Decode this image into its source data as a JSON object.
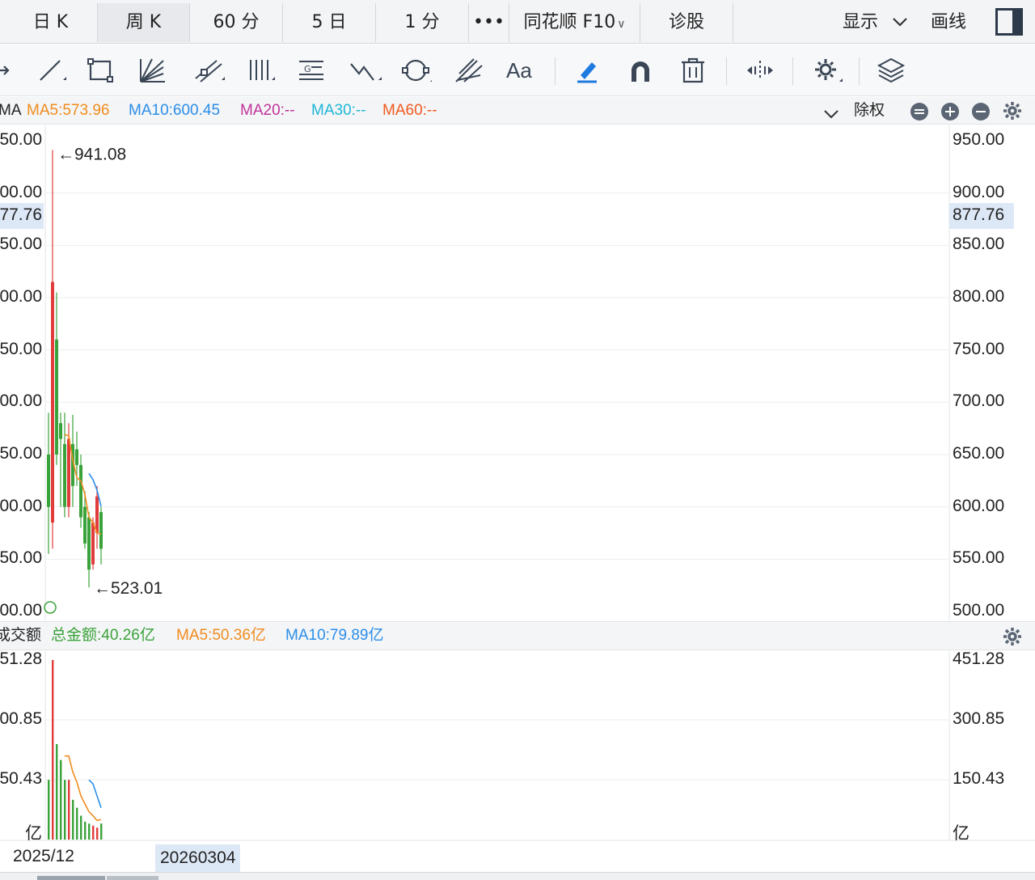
{
  "tabs": [
    {
      "label": "日 K",
      "active": false
    },
    {
      "label": "周 K",
      "active": true
    },
    {
      "label": "60 分",
      "active": false
    },
    {
      "label": "5 日",
      "active": false
    },
    {
      "label": "1 分",
      "active": false
    },
    {
      "label": "•••",
      "active": false
    },
    {
      "label": "同花顺 F10",
      "active": false
    },
    {
      "label": "诊股",
      "active": false
    }
  ],
  "header_right": {
    "display_label": "显示",
    "draw_label": "画线"
  },
  "toolbar_icons": [
    "arrow-icon",
    "line-icon",
    "rectangle-icon",
    "fan-icon",
    "parallel-channel-icon",
    "vertical-lines-icon",
    "gann-icon",
    "wave-icon",
    "cycle-icon",
    "pitchfork-icon",
    "text-icon",
    "highlighter-icon",
    "magnet-icon",
    "trash-icon",
    "resize-icon",
    "settings-icon",
    "layers-icon"
  ],
  "toolbar_text_label": "Aa",
  "ma_legend": {
    "prefix": "MA",
    "ma5": "MA5:573.96",
    "ma10": "MA10:600.45",
    "ma20": "MA20:--",
    "ma30": "MA30:--",
    "ma60": "MA60:--",
    "adjust_label": "除权",
    "colors": {
      "ma5": "#f08c1e",
      "ma10": "#2b8ee8",
      "ma20": "#c0349a",
      "ma30": "#1fb7d6",
      "ma60": "#ef5a1f"
    }
  },
  "volume_legend": {
    "prefix": "成交额",
    "total": "总金额:40.26亿",
    "ma5": "MA5:50.36亿",
    "ma10": "MA10:79.89亿",
    "colors": {
      "total": "#3aa23a",
      "ma5": "#f08c1e",
      "ma10": "#2b8ee8"
    }
  },
  "chart_data": {
    "type": "candlestick",
    "period": "weekly",
    "price_axis": {
      "ticks": [
        "950.00",
        "900.00",
        "850.00",
        "800.00",
        "750.00",
        "700.00",
        "650.00",
        "600.00",
        "550.00",
        "500.00"
      ],
      "current_value": "877.76",
      "ylim": [
        500,
        950
      ]
    },
    "annotations": {
      "high": "←941.08",
      "low": "←523.01"
    },
    "colors": {
      "up": "#e23b3b",
      "down": "#3aa23a",
      "ma5": "#f08c1e",
      "ma10": "#2b8ee8"
    },
    "candles": [
      {
        "o": 650,
        "c": 600,
        "h": 690,
        "l": 555
      },
      {
        "o": 585,
        "c": 815,
        "h": 941.08,
        "l": 560
      },
      {
        "o": 760,
        "c": 650,
        "h": 805,
        "l": 640
      },
      {
        "o": 680,
        "c": 665,
        "h": 690,
        "l": 600
      },
      {
        "o": 660,
        "c": 600,
        "h": 690,
        "l": 590
      },
      {
        "o": 600,
        "c": 665,
        "h": 680,
        "l": 590
      },
      {
        "o": 660,
        "c": 620,
        "h": 688,
        "l": 600
      },
      {
        "o": 655,
        "c": 640,
        "h": 672,
        "l": 620
      },
      {
        "o": 640,
        "c": 590,
        "h": 650,
        "l": 580
      },
      {
        "o": 600,
        "c": 565,
        "h": 615,
        "l": 560
      },
      {
        "o": 590,
        "c": 540,
        "h": 595,
        "l": 523.01
      },
      {
        "o": 545,
        "c": 585,
        "h": 590,
        "l": 540
      },
      {
        "o": 575,
        "c": 610,
        "h": 620,
        "l": 560
      },
      {
        "o": 595,
        "c": 560,
        "h": 600,
        "l": 545
      }
    ],
    "ma5": [
      null,
      null,
      null,
      null,
      669,
      668,
      645,
      628,
      625,
      612,
      590,
      585,
      575,
      573.96
    ],
    "ma10": [
      null,
      null,
      null,
      null,
      null,
      null,
      null,
      null,
      null,
      null,
      632,
      626,
      616,
      600.45
    ],
    "volume_axis": {
      "ticks": [
        "451.28",
        "300.85",
        "150.43"
      ],
      "unit": "亿",
      "ylim": [
        0,
        451.28
      ]
    },
    "volume": [
      150,
      451.28,
      240,
      200,
      150,
      150,
      100,
      80,
      60,
      45,
      40,
      35,
      30,
      40.26
    ],
    "volume_ma5": [
      null,
      null,
      null,
      null,
      210,
      210,
      170,
      145,
      110,
      90,
      70,
      60,
      48,
      50.36
    ],
    "volume_ma10": [
      null,
      null,
      null,
      null,
      null,
      null,
      null,
      null,
      null,
      null,
      150,
      140,
      110,
      79.89
    ],
    "x_labels": {
      "start": "2025/12",
      "cursor": "20260304"
    }
  }
}
